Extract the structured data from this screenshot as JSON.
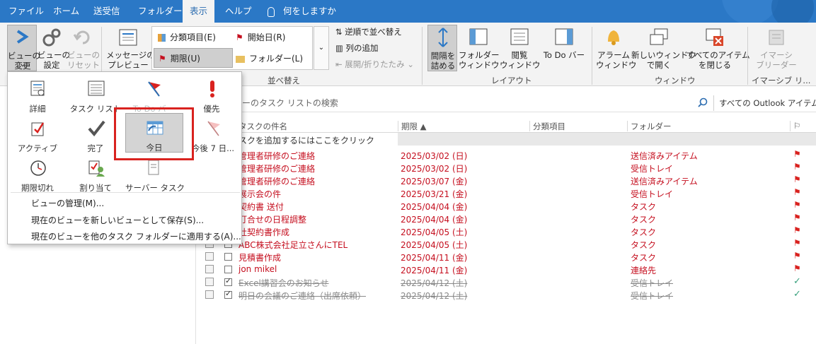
{
  "tabs": [
    "ファイル",
    "ホーム",
    "送受信",
    "フォルダー",
    "表示",
    "ヘルプ",
    "何をしますか"
  ],
  "ribbon": {
    "change_view": "ビューの\n変更",
    "view_settings": "ビューの\n設定",
    "reset_view": "ビューの\nリセット",
    "message_preview": "メッセージの\nプレビュー",
    "sort_items": [
      "分類項目(E)",
      "開始日(R)",
      "期限(U)",
      "フォルダー(L)"
    ],
    "reverse_sort": "逆順で並べ替え",
    "add_column": "列の追加",
    "expand_collapse": "展開/折りたたみ",
    "sort_group": "並べ替え",
    "folder_pane": "フォルダー\nウィンドウ",
    "reading_pane": "閲覧\nウィンドウ",
    "todo_bar": "To Do バー",
    "spacing": "間隔を\n詰める",
    "layout_group": "レイアウト",
    "reminders": "アラーム\nウィンドウ",
    "new_window": "新しいウィンドウ\nで開く",
    "close_all": "すべてのアイテム\nを閉じる",
    "window_group": "ウィンドウ",
    "immersive": "イマーシ\nブリーダー",
    "immersive_group": "イマーシブ リ..."
  },
  "search": {
    "placeholder": "バーのタスク リストの検索",
    "scope": "すべての Outlook アイテム"
  },
  "columns": {
    "subject": "タスクの件名",
    "due": "期限",
    "category": "分類項目",
    "folder": "フォルダー"
  },
  "add_task_hint": "スクを追加するにはここをクリック",
  "tasks": [
    {
      "subject": "管理者研修のご連絡",
      "due": "2025/03/02 (日)",
      "folder": "送信済みアイテム",
      "state": "overdue"
    },
    {
      "subject": "管理者研修のご連絡",
      "due": "2025/03/02 (日)",
      "folder": "受信トレイ",
      "state": "overdue"
    },
    {
      "subject": "管理者研修のご連絡",
      "due": "2025/03/07 (金)",
      "folder": "送信済みアイテム",
      "state": "overdue"
    },
    {
      "subject": "展示会の件",
      "due": "2025/03/21 (金)",
      "folder": "受信トレイ",
      "state": "overdue"
    },
    {
      "subject": "契約書 送付",
      "due": "2025/04/04 (金)",
      "folder": "タスク",
      "state": "overdue"
    },
    {
      "subject": "打合せの日程調整",
      "due": "2025/04/04 (金)",
      "folder": "タスク",
      "state": "overdue"
    },
    {
      "subject": "社契約書作成",
      "due": "2025/04/05 (土)",
      "folder": "タスク",
      "state": "overdue"
    },
    {
      "subject": "ABC株式会社足立さんにTEL",
      "due": "2025/04/05 (土)",
      "folder": "タスク",
      "state": "overdue"
    },
    {
      "subject": "見積書作成",
      "due": "2025/04/11 (金)",
      "folder": "タスク",
      "state": "overdue"
    },
    {
      "subject": "jon mikel",
      "due": "2025/04/11 (金)",
      "folder": "連絡先",
      "state": "overdue"
    },
    {
      "subject": "Excel講習会のお知らせ",
      "due": "2025/04/12 (土)",
      "folder": "受信トレイ",
      "state": "done"
    },
    {
      "subject": "明日の会議のご連絡（出席依頼）",
      "due": "2025/04/12 (土)",
      "folder": "受信トレイ",
      "state": "done"
    }
  ],
  "views": [
    "詳細",
    "タスク リスト",
    "To Do バー",
    "優先",
    "アクティブ",
    "完了",
    "今日",
    "今後 7 日...",
    "期限切れ",
    "割り当て",
    "サーバー タスク"
  ],
  "menu": [
    "ビューの管理(M)...",
    "現在のビューを新しいビューとして保存(S)...",
    "現在のビューを他のタスク フォルダーに適用する(A)..."
  ],
  "colors": {
    "accent": "#2b78c6",
    "overdue": "#c50f1f",
    "highlight": "#d9221f"
  }
}
